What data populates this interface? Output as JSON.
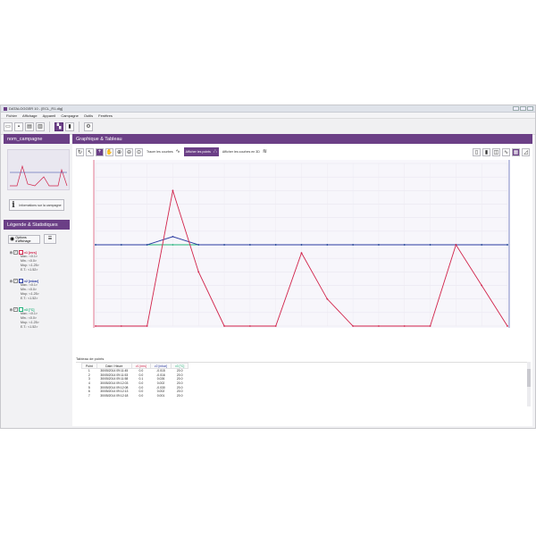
{
  "window": {
    "title": "DATALOGGER 10 - [ECL_R1.dlg]"
  },
  "menu": [
    "Fichier",
    "Affichage",
    "Appareil",
    "Campagne",
    "Outils",
    "Fenêtres"
  ],
  "sidebar": {
    "campaign_title": "nom_campagne",
    "info_button": "Informations sur la campagne",
    "legend_title": "Légende & Statistiques",
    "options_button": "Options d'affichage",
    "series": [
      {
        "name": "v1 [mrs]",
        "color": "#d1234a",
        "stats": [
          "Max.: <0.1>",
          "Min.: <0.0>",
          "Moy.: <1.25>",
          "E.T.: <1.52>"
        ]
      },
      {
        "name": "v2 [mbar]",
        "color": "#2a3ba0",
        "stats": [
          "Max.: <0.1>",
          "Min.: <0.0>",
          "Moy.: <1.25>",
          "E.T.: <1.52>"
        ]
      },
      {
        "name": "v3 [°C]",
        "color": "#20b27a",
        "stats": [
          "Max.: <0.1>",
          "Min.: <0.0>",
          "Moy.: <1.25>",
          "E.T.: <1.52>"
        ]
      }
    ]
  },
  "main": {
    "title": "Graphique & Tableau",
    "modes": [
      "Tracer les courbes",
      "Afficher les points",
      "Afficher les courbes en 3D"
    ],
    "table_title": "Tableau de points"
  },
  "chart_data": {
    "type": "line",
    "x": [
      1,
      2,
      3,
      4,
      5,
      6,
      7,
      8,
      9,
      10,
      11,
      12,
      13,
      14,
      15,
      16,
      17
    ],
    "series": [
      {
        "name": "v1 [mrs]",
        "color": "#d1234a",
        "values": [
          0.0,
          0.0,
          0.0,
          5.0,
          2.0,
          0.0,
          0.0,
          0.0,
          2.7,
          1.0,
          0.0,
          0.0,
          0.0,
          0.0,
          3.0,
          1.5,
          0.0
        ]
      },
      {
        "name": "v2 [mbar]",
        "color": "#2a3ba0",
        "values": [
          3.0,
          3.0,
          3.0,
          3.3,
          3.0,
          3.0,
          3.0,
          3.0,
          3.0,
          3.0,
          3.0,
          3.0,
          3.0,
          3.0,
          3.0,
          3.0,
          3.0
        ]
      },
      {
        "name": "v3 [°C]",
        "color": "#20b27a",
        "values": [
          3.0,
          3.0,
          3.0,
          3.0,
          3.0,
          3.0,
          3.0,
          3.0,
          3.0,
          3.0,
          3.0,
          3.0,
          3.0,
          3.0,
          3.0,
          3.0,
          3.0
        ]
      }
    ],
    "ylim": [
      0,
      6
    ]
  },
  "table": {
    "headers": [
      "Point",
      "Date / Heure",
      "v1 [mrs]",
      "v2 [mbar]",
      "v3 [°C]"
    ],
    "rows": [
      [
        "1",
        "30/05/2014 09:11:45",
        "0.0",
        "-0.015",
        "20.0"
      ],
      [
        "2",
        "30/05/2014 09:11:53",
        "0.0",
        "-0.016",
        "20.0"
      ],
      [
        "3",
        "30/05/2014 09:11:58",
        "0.1",
        "0.026",
        "20.0"
      ],
      [
        "4",
        "30/05/2014 09:12:03",
        "0.0",
        "0.002",
        "20.0"
      ],
      [
        "5",
        "30/05/2014 09:12:08",
        "0.0",
        "-0.030",
        "20.0"
      ],
      [
        "6",
        "30/05/2014 09:12:13",
        "0.0",
        "0.002",
        "20.0"
      ],
      [
        "7",
        "30/05/2014 09:12:18",
        "0.0",
        "0.001",
        "20.0"
      ]
    ]
  }
}
